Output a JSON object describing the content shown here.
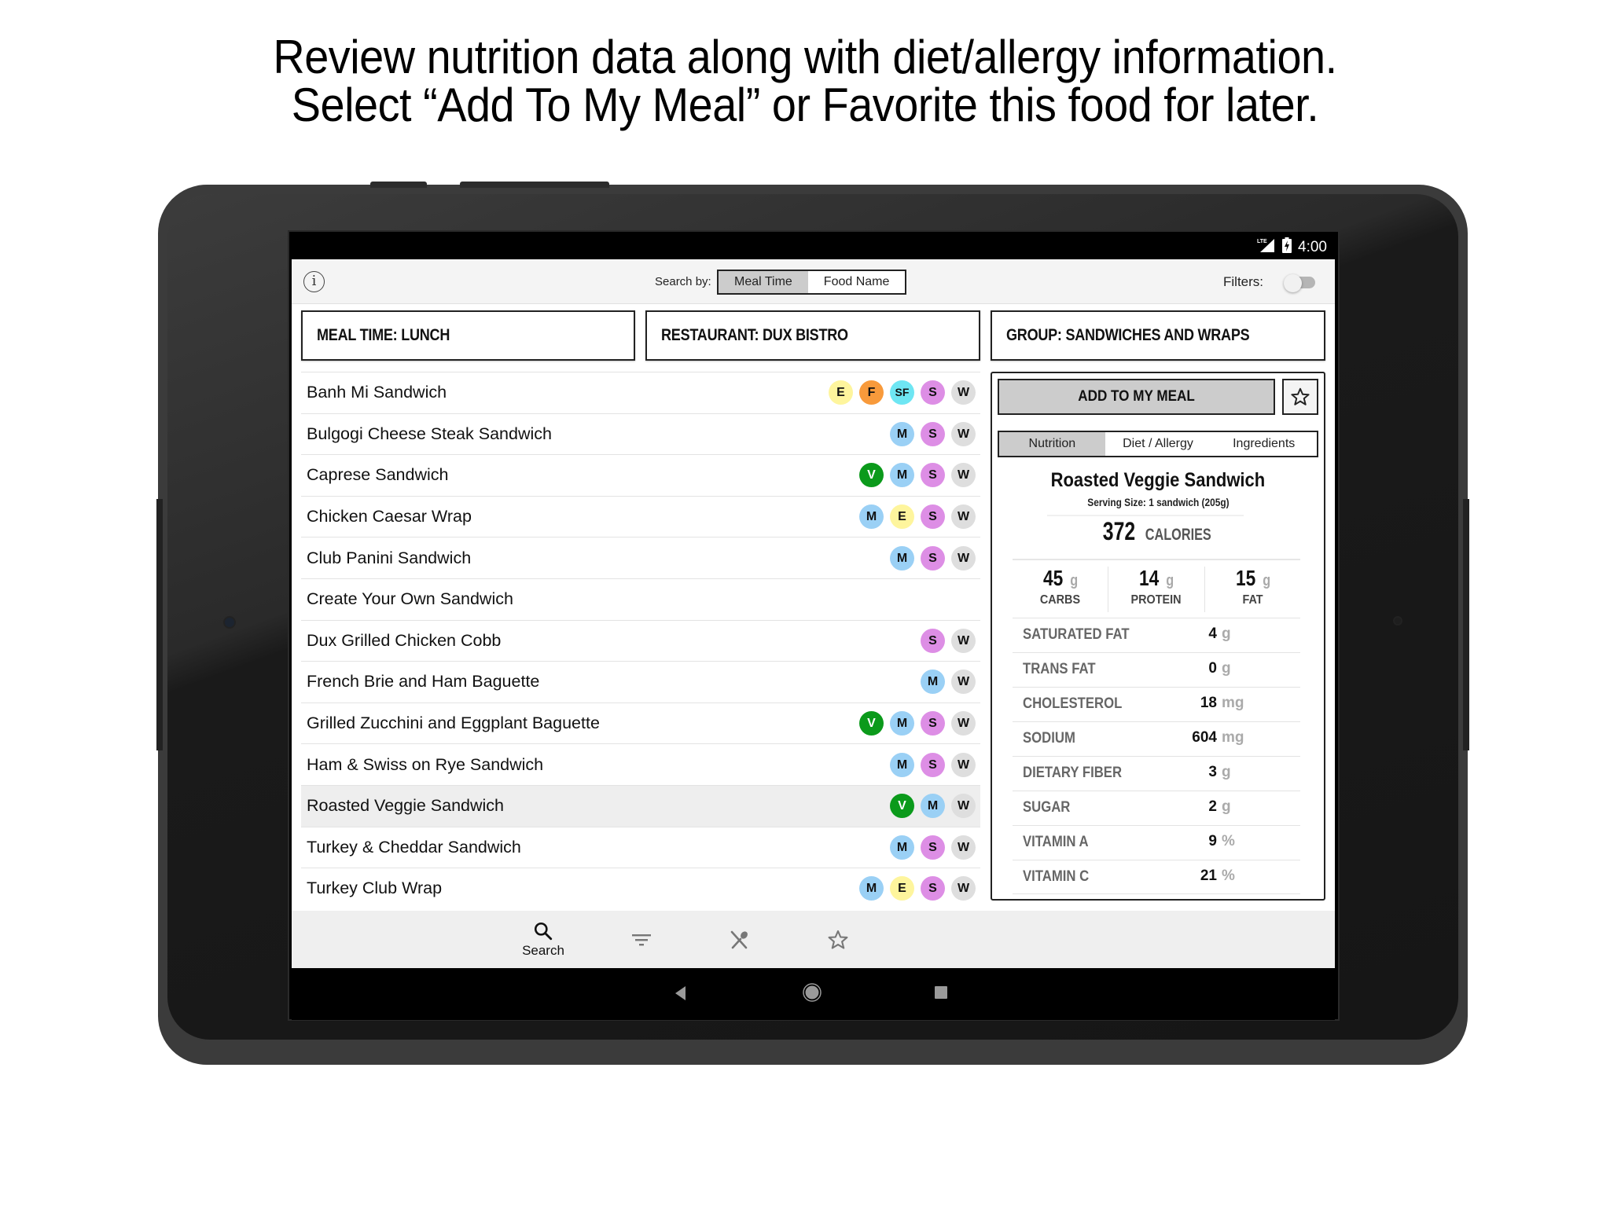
{
  "headline": {
    "line1": "Review nutrition data along with diet/allergy information.",
    "line2": "Select “Add To My Meal” or Favorite this food for later."
  },
  "status_bar": {
    "network": "LTE",
    "signal_icon": "cell-signal-icon",
    "battery_icon": "battery-charging-icon",
    "time": "4:00"
  },
  "topbar": {
    "info_icon": "info-icon",
    "search_by_label": "Search by:",
    "search_options": [
      {
        "label": "Meal Time",
        "active": true
      },
      {
        "label": "Food Name",
        "active": false
      }
    ],
    "filters_label": "Filters:",
    "filters_enabled": false
  },
  "headers": {
    "meal_time": "MEAL TIME: LUNCH",
    "restaurant": "RESTAURANT: DUX BISTRO",
    "group": "GROUP: SANDWICHES AND WRAPS"
  },
  "badge_colors": {
    "E": "#fef59d",
    "F": "#f89a3b",
    "SF": "#6ee6f3",
    "S": "#dd8ee5",
    "W": "#dedede",
    "M": "#9ad0f5",
    "V": "#0b9a1b"
  },
  "foods": [
    {
      "name": "Banh Mi Sandwich",
      "badges": [
        "E",
        "F",
        "SF",
        "S",
        "W"
      ],
      "selected": false
    },
    {
      "name": "Bulgogi Cheese Steak Sandwich",
      "badges": [
        "M",
        "S",
        "W"
      ],
      "selected": false
    },
    {
      "name": "Caprese Sandwich",
      "badges": [
        "V",
        "M",
        "S",
        "W"
      ],
      "selected": false
    },
    {
      "name": "Chicken Caesar Wrap",
      "badges": [
        "M",
        "E",
        "S",
        "W"
      ],
      "selected": false
    },
    {
      "name": "Club Panini Sandwich",
      "badges": [
        "M",
        "S",
        "W"
      ],
      "selected": false
    },
    {
      "name": "Create Your Own Sandwich",
      "badges": [],
      "selected": false
    },
    {
      "name": "Dux Grilled Chicken Cobb",
      "badges": [
        "S",
        "W"
      ],
      "selected": false
    },
    {
      "name": "French Brie and Ham Baguette",
      "badges": [
        "M",
        "W"
      ],
      "selected": false
    },
    {
      "name": "Grilled Zucchini and Eggplant Baguette",
      "badges": [
        "V",
        "M",
        "S",
        "W"
      ],
      "selected": false
    },
    {
      "name": "Ham & Swiss on Rye Sandwich",
      "badges": [
        "M",
        "S",
        "W"
      ],
      "selected": false
    },
    {
      "name": "Roasted Veggie Sandwich",
      "badges": [
        "V",
        "M",
        "W"
      ],
      "selected": true
    },
    {
      "name": "Turkey & Cheddar Sandwich",
      "badges": [
        "M",
        "S",
        "W"
      ],
      "selected": false
    },
    {
      "name": "Turkey Club Wrap",
      "badges": [
        "M",
        "E",
        "S",
        "W"
      ],
      "selected": false
    }
  ],
  "detail": {
    "add_button_label": "ADD TO MY MEAL",
    "favorite_icon": "star-outline-icon",
    "tabs": [
      {
        "label": "Nutrition",
        "active": true
      },
      {
        "label": "Diet / Allergy",
        "active": false
      },
      {
        "label": "Ingredients",
        "active": false
      }
    ],
    "food_title": "Roasted Veggie Sandwich",
    "serving_size": "Serving Size: 1 sandwich (205g)",
    "calories": "372",
    "calories_label": "CALORIES",
    "macros": [
      {
        "value": "45",
        "unit": "g",
        "label": "CARBS"
      },
      {
        "value": "14",
        "unit": "g",
        "label": "PROTEIN"
      },
      {
        "value": "15",
        "unit": "g",
        "label": "FAT"
      }
    ],
    "nutrients": [
      {
        "name": "SATURATED FAT",
        "value": "4",
        "unit": "g"
      },
      {
        "name": "TRANS FAT",
        "value": "0",
        "unit": "g"
      },
      {
        "name": "CHOLESTEROL",
        "value": "18",
        "unit": "mg"
      },
      {
        "name": "SODIUM",
        "value": "604",
        "unit": "mg"
      },
      {
        "name": "DIETARY FIBER",
        "value": "3",
        "unit": "g"
      },
      {
        "name": "SUGAR",
        "value": "2",
        "unit": "g"
      },
      {
        "name": "VITAMIN A",
        "value": "9",
        "unit": "%"
      },
      {
        "name": "VITAMIN C",
        "value": "21",
        "unit": "%"
      }
    ]
  },
  "bottom_nav": [
    {
      "icon": "search-icon",
      "label": "Search",
      "active": true
    },
    {
      "icon": "filter-icon",
      "label": "",
      "active": false
    },
    {
      "icon": "utensils-icon",
      "label": "",
      "active": false
    },
    {
      "icon": "star-icon",
      "label": "",
      "active": false
    }
  ],
  "android_nav": {
    "back": "back-icon",
    "home": "home-icon",
    "recents": "recents-icon"
  }
}
